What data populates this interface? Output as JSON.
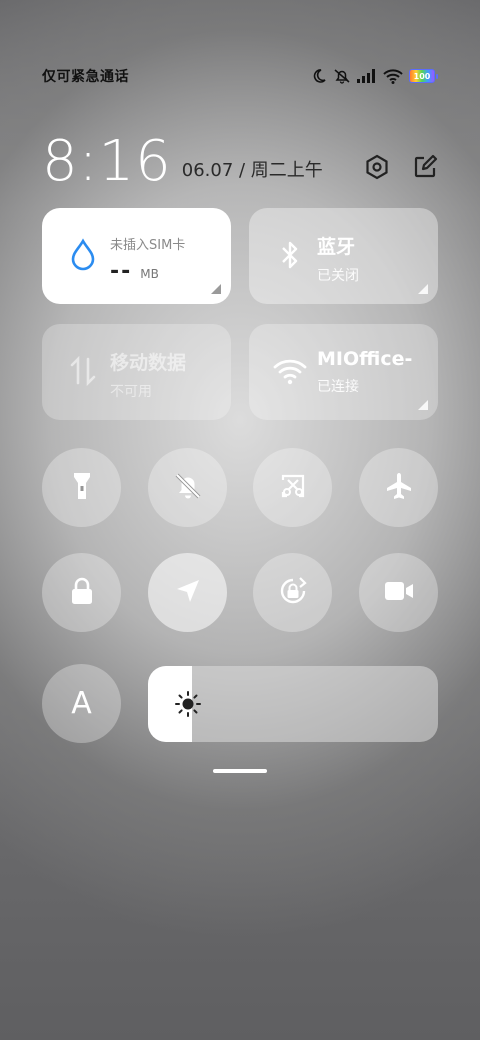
{
  "status_bar": {
    "carrier": "仅可紧急通话",
    "icons": [
      "moon-icon",
      "mute-icon",
      "signal-icon",
      "wifi-icon",
      "battery-icon"
    ],
    "battery_level": "100"
  },
  "header": {
    "time": "8:16",
    "date": "06.07 / 周二上午",
    "actions": [
      "settings-icon",
      "edit-icon"
    ]
  },
  "tiles": {
    "data": {
      "title": "未插入SIM卡",
      "value": "--",
      "unit": "MB",
      "accent": "#2b8cf0"
    },
    "bluetooth": {
      "title": "蓝牙",
      "status": "已关闭"
    },
    "mobile_data": {
      "title": "移动数据",
      "status": "不可用"
    },
    "wifi": {
      "title": "MIOffice-",
      "status": "已连接"
    }
  },
  "toggles_row1": [
    "flashlight-icon",
    "mute-bell-icon",
    "screenshot-icon",
    "airplane-icon"
  ],
  "toggles_row2": [
    "lock-icon",
    "location-icon",
    "rotation-lock-icon",
    "video-icon"
  ],
  "auto_font": {
    "label": "A"
  },
  "brightness": {
    "level": 0.15
  }
}
